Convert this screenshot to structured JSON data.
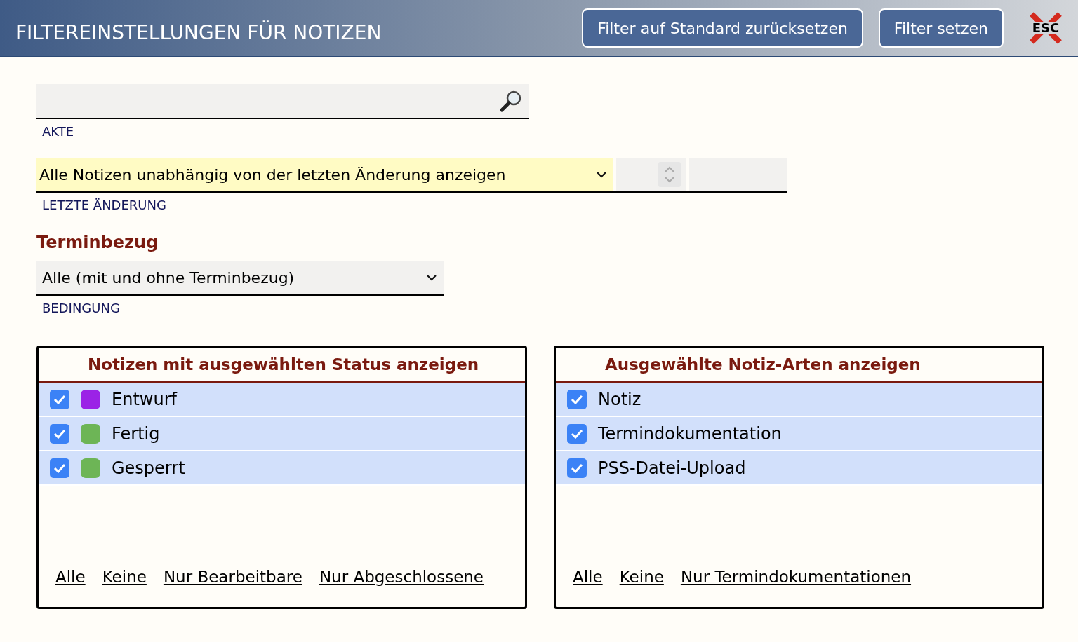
{
  "header": {
    "title": "FILTEREINSTELLUNGEN FÜR NOTIZEN",
    "buttons": [
      "Filter auf Standard zurücksetzen",
      "Filter setzen"
    ],
    "close_label": "ESC"
  },
  "akte": {
    "label": "AKTE"
  },
  "letzte_aenderung": {
    "value": "Alle Notizen unabhängig von der letzten Änderung anzeigen",
    "label": "LETZTE ÄNDERUNG"
  },
  "terminbezug": {
    "heading": "Terminbezug",
    "value": "Alle (mit und ohne Terminbezug)",
    "label": "BEDINGUNG"
  },
  "panels": [
    {
      "title": "Notizen mit ausgewählten Status anzeigen",
      "items": [
        {
          "label": "Entwurf",
          "checked": true,
          "color": "#9b23e6"
        },
        {
          "label": "Fertig",
          "checked": true,
          "color": "#6db556"
        },
        {
          "label": "Gesperrt",
          "checked": true,
          "color": "#6db556"
        }
      ],
      "links": [
        "Alle",
        "Keine",
        "Nur Bearbeitbare",
        "Nur Abgeschlossene"
      ]
    },
    {
      "title": "Ausgewählte Notiz-Arten anzeigen",
      "items": [
        {
          "label": "Notiz",
          "checked": true
        },
        {
          "label": "Termindokumentation",
          "checked": true
        },
        {
          "label": "PSS-Datei-Upload",
          "checked": true
        }
      ],
      "links": [
        "Alle",
        "Keine",
        "Nur Termindokumentationen"
      ]
    }
  ]
}
